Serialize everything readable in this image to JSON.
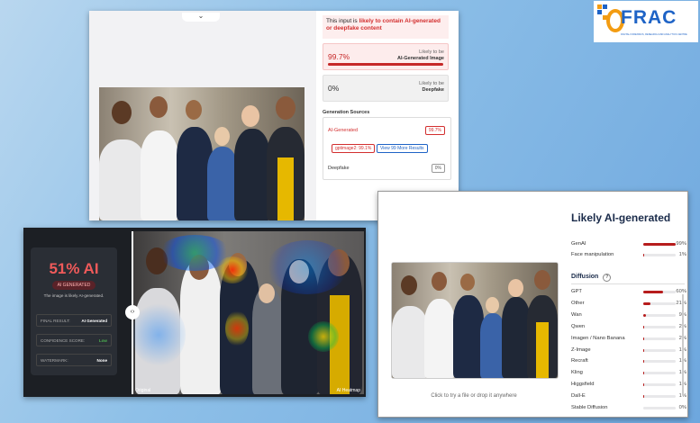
{
  "top_panel": {
    "chevron": "⌄",
    "warning_prefix": "This input is ",
    "warning_highlight": "likely to contain AI-generated or deepfake content",
    "ai_score": {
      "pct": "99.7%",
      "label_line1": "Likely to be",
      "label_line2": "AI-Generated Image",
      "fraction": 0.997
    },
    "deepfake_score": {
      "pct": "0%",
      "label_line1": "Likely to be",
      "label_line2": "Deepfake",
      "fraction": 0
    },
    "generation_sources_title": "Generation Sources",
    "ai_generated_label": "AI-Generated",
    "ai_generated_pct": "99.7%",
    "gpt_tag": "gptimage2: 99.1%",
    "more_results": "View 99 More Results",
    "deepfake_label": "Deepfake",
    "deepfake_pct": "0%"
  },
  "heatmap_panel": {
    "score": "51% AI",
    "badge": "AI GENERATED",
    "subtitle": "The image is likely AI-generated.",
    "rows": [
      {
        "k": "FINAL RESULT:",
        "v": "AI Generated"
      },
      {
        "k": "CONFIDENCE SCORE:",
        "v": "Low"
      },
      {
        "k": "WATERMARK:",
        "v": "None"
      }
    ],
    "handle": "‹›",
    "caption_left": "Original",
    "caption_right": "AI Heatmap"
  },
  "result_panel": {
    "title": "Likely AI-generated",
    "top_rows": [
      {
        "name": "GenAI",
        "pct": "99%",
        "value": 0.99
      },
      {
        "name": "Face manipulation",
        "pct": "1%",
        "value": 0.01
      }
    ],
    "section": "Diffusion",
    "section_icon": "?",
    "diffusion_rows": [
      {
        "name": "GPT",
        "pct": "60%",
        "value": 0.6
      },
      {
        "name": "Other",
        "pct": "21%",
        "value": 0.21
      },
      {
        "name": "Wan",
        "pct": "9%",
        "value": 0.09
      },
      {
        "name": "Qwen",
        "pct": "2%",
        "value": 0.02
      },
      {
        "name": "Imagen / Nano Banana",
        "pct": "2%",
        "value": 0.02
      },
      {
        "name": "Z-Image",
        "pct": "1%",
        "value": 0.01
      },
      {
        "name": "Recraft",
        "pct": "1%",
        "value": 0.01
      },
      {
        "name": "Kling",
        "pct": "1%",
        "value": 0.01
      },
      {
        "name": "Higgsfield",
        "pct": "1%",
        "value": 0.01
      },
      {
        "name": "Dall-E",
        "pct": "1%",
        "value": 0.01
      },
      {
        "name": "Stable Diffusion",
        "pct": "0%",
        "value": 0.0
      }
    ],
    "hint": "Click to try a file or drop it anywhere"
  },
  "logo": {
    "text": "FRAC",
    "tagline": "DIGITAL FORENSICS, RESEARCH AND ANALYTICS CENTRE"
  },
  "colors": {
    "accent_red": "#c62828",
    "brand_blue": "#1e63c6",
    "brand_orange": "#f39c12"
  }
}
